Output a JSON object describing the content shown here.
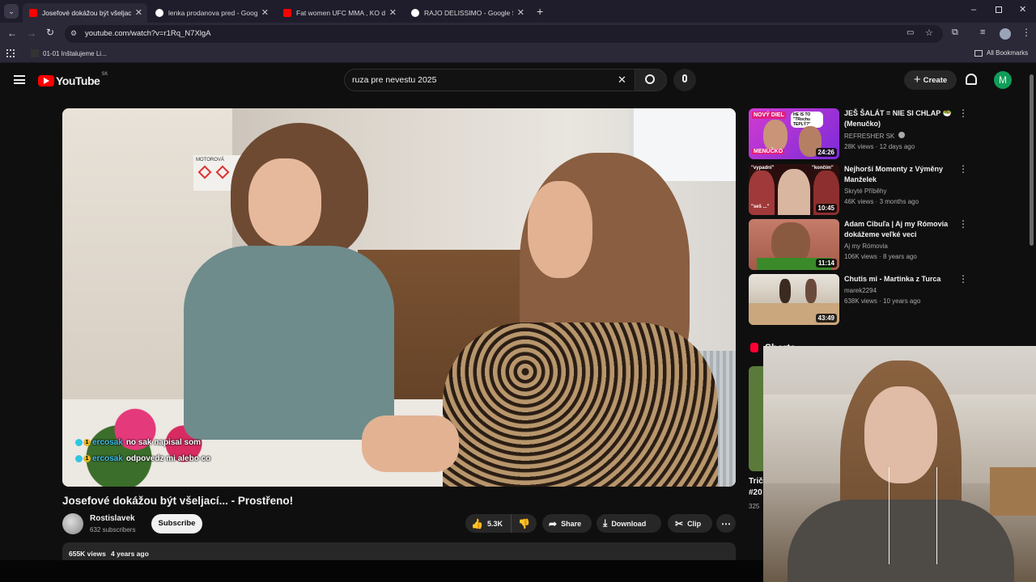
{
  "browser": {
    "tabs": [
      {
        "title": "Josefové dokážou být všeljací...",
        "icon": "youtube-favicon",
        "active": true
      },
      {
        "title": "lenka prodanova pred - Google",
        "icon": "google-favicon",
        "active": false
      },
      {
        "title": "Fat women UFC MMA , KO d Ha",
        "icon": "youtube-favicon",
        "active": false
      },
      {
        "title": "RAJO DELISSIMO - Google Sear",
        "icon": "google-favicon",
        "active": false
      }
    ],
    "url": "youtube.com/watch?v=r1Rq_N7XlgA",
    "bookmark_item": "01-01 Inštalujeme Li...",
    "all_bookmarks": "All Bookmarks"
  },
  "youtube": {
    "logo_text": "YouTube",
    "country_code": "SK",
    "search_value": "ruza pre nevestu 2025",
    "create_label": "Create",
    "avatar_letter": "M",
    "avatar_color": "#0f9d58"
  },
  "video": {
    "title": "Josefové dokážou být všeljací... - Prostřeno!",
    "channel": "Rostislavek",
    "subscribers": "632 subscribers",
    "subscribe_label": "Subscribe",
    "likes": "5.3K",
    "share_label": "Share",
    "download_label": "Download",
    "clip_label": "Clip",
    "views": "655K views",
    "age": "4 years ago",
    "chat": [
      {
        "user": "ercosak",
        "badge": "1",
        "text": "no sak napisal som"
      },
      {
        "user": "ercosak",
        "badge": "1",
        "text": "odpovedz mi alebo co"
      }
    ],
    "sign_text": "MOTOROVÁ"
  },
  "recommendations": [
    {
      "title": "JEŠ ŠALÁT = NIE SI CHLAP 🥗 (Menučko)",
      "channel": "REFRESHER SK",
      "verified": true,
      "meta": "28K views · 12 days ago",
      "duration": "24:26",
      "thumb_text": "NOVÝ DIEL",
      "thumb_sub": "MENUČKO",
      "thumb_q": "HE IS TO \"TRochu TEPLÝ?\""
    },
    {
      "title": "Nejhorší Momenty z Výměny Manželek",
      "channel": "Skryté Příběhy",
      "verified": false,
      "meta": "46K views · 3 months ago",
      "duration": "10:45",
      "thumb_text": "\"vypadni\"",
      "thumb_sub": "\"seš ...\"",
      "thumb_q": "\"končím\""
    },
    {
      "title": "Adam Cibuľa | Aj my Rómovia dokážeme veľké veci",
      "channel": "Aj my Rómovia",
      "verified": false,
      "meta": "106K views · 8 years ago",
      "duration": "11:14"
    },
    {
      "title": "Chutis mi - Martinka z Turca",
      "channel": "marek2294",
      "verified": false,
      "meta": "638K views · 10 years ago",
      "duration": "43:49"
    }
  ],
  "shorts": {
    "label": "Shorts",
    "partial_title_1": "Trič",
    "partial_title_2": "#20",
    "partial_meta": "325"
  }
}
